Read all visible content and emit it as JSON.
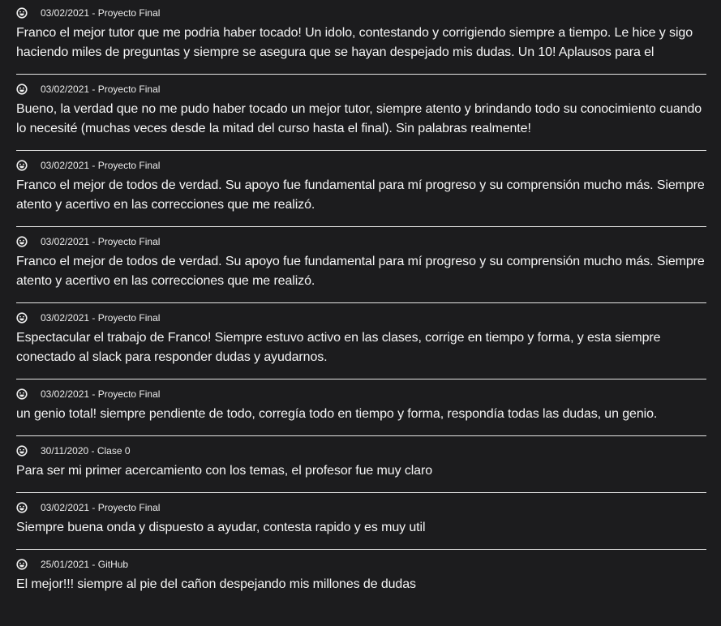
{
  "reviews": [
    {
      "icon": "smiley-face-icon",
      "date": "03/02/2021",
      "separator": " - ",
      "course": "Proyecto Final",
      "text": "Franco el mejor tutor que me podria haber tocado! Un idolo, contestando y corrigiendo siempre a tiempo. Le hice y sigo haciendo miles de preguntas y siempre se asegura que se hayan despejado mis dudas. Un 10! Aplausos para el"
    },
    {
      "icon": "smiley-face-icon",
      "date": "03/02/2021",
      "separator": " - ",
      "course": "Proyecto Final",
      "text": "Bueno, la verdad que no me pudo haber tocado un mejor tutor, siempre atento y brindando todo su conocimiento cuando lo necesité (muchas veces desde la mitad del curso hasta el final). Sin palabras realmente!"
    },
    {
      "icon": "smiley-face-icon",
      "date": "03/02/2021",
      "separator": " - ",
      "course": "Proyecto Final",
      "text": "Franco el mejor de todos de verdad. Su apoyo fue fundamental para mí progreso y su comprensión mucho más. Siempre atento y acertivo en las correcciones que me realizó."
    },
    {
      "icon": "smiley-face-icon",
      "date": "03/02/2021",
      "separator": " - ",
      "course": "Proyecto Final",
      "text": "Franco el mejor de todos de verdad. Su apoyo fue fundamental para mí progreso y su comprensión mucho más. Siempre atento y acertivo en las correcciones que me realizó."
    },
    {
      "icon": "smiley-face-icon",
      "date": "03/02/2021",
      "separator": " - ",
      "course": "Proyecto Final",
      "text": "Espectacular el trabajo de Franco! Siempre estuvo activo en las clases, corrige en tiempo y forma, y esta siempre conectado al slack para responder dudas y ayudarnos."
    },
    {
      "icon": "smiley-face-icon",
      "date": "03/02/2021",
      "separator": " - ",
      "course": "Proyecto Final",
      "text": "un genio total! siempre pendiente de todo, corregía todo en tiempo y forma, respondía todas las dudas, un genio."
    },
    {
      "icon": "smiley-face-icon",
      "date": "30/11/2020",
      "separator": " - ",
      "course": "Clase 0",
      "text": "Para ser mi primer acercamiento con los temas, el profesor fue muy claro"
    },
    {
      "icon": "smiley-face-icon",
      "date": "03/02/2021",
      "separator": " - ",
      "course": "Proyecto Final",
      "text": "Siempre buena onda y dispuesto a ayudar, contesta rapido y es muy util"
    },
    {
      "icon": "smiley-face-icon",
      "date": "25/01/2021",
      "separator": " - ",
      "course": "GitHub",
      "text": "El mejor!!! siempre al pie del cañon despejando mis millones de dudas"
    }
  ],
  "colors": {
    "background": "#1c1c1e",
    "text": "#f4f4f4",
    "divider": "#e6e6e6"
  }
}
